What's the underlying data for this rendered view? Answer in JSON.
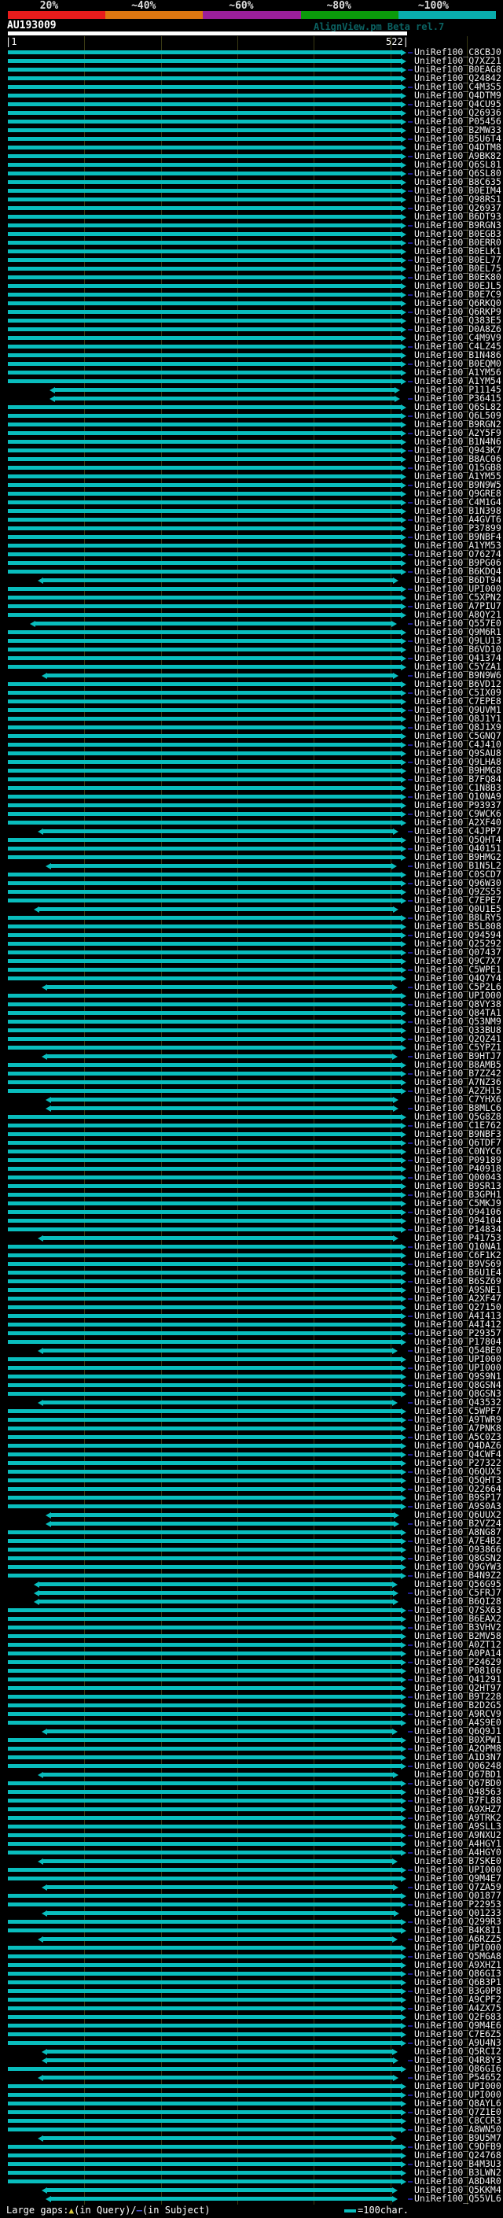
{
  "colors": {
    "background": "#000000",
    "alignment_bar": "#09bdbd",
    "subject_tail": "#1d1d8e",
    "query_bar": "#ffffff",
    "gridline": "#3a3a14",
    "label_text": "#ececec",
    "watermark_text": "#0b6161",
    "gap_query_symbol": "#d8c83c",
    "gap_subject_symbol": "#4a55c8"
  },
  "chart_data": {
    "type": "bar",
    "orientation": "horizontal",
    "title": "AU193009",
    "watermark": "AlignView.pm Beta rel.7",
    "x_axis": {
      "start": 1,
      "end": 522,
      "start_label": "|1",
      "end_label": "522|",
      "gridline_interval_chars": 100,
      "unit": "char"
    },
    "identity_scale": {
      "segments": [
        {
          "label": "20%",
          "color": "#e81c1c"
        },
        {
          "label": "~40%",
          "color": "#dd7711"
        },
        {
          "label": "~60%",
          "color": "#9b1f9b"
        },
        {
          "label": "~80%",
          "color": "#0b9b0b"
        },
        {
          "label": "~100%",
          "color": "#09adad"
        }
      ]
    },
    "legend": {
      "large_gaps_label": "Large gaps:",
      "query_symbol": "▲",
      "query_text": "(in Query)/",
      "subject_symbol": "—",
      "subject_text": "(in Subject)",
      "scale_note": "=100char."
    },
    "bars": [
      [
        "UniRef100_C8CBJ0",
        1,
        522
      ],
      [
        "UniRef100_Q7XZ21",
        1,
        522
      ],
      [
        "UniRef100_B0EAG8",
        1,
        522
      ],
      [
        "UniRef100_Q24842",
        1,
        522
      ],
      [
        "UniRef100_C4M3S5",
        1,
        522
      ],
      [
        "UniRef100_Q4DTM9",
        1,
        522
      ],
      [
        "UniRef100_Q4CU95",
        1,
        522
      ],
      [
        "UniRef100_Q26936",
        1,
        522
      ],
      [
        "UniRef100_P05456",
        1,
        522
      ],
      [
        "UniRef100_B2MW33",
        1,
        522
      ],
      [
        "UniRef100_B5U6T4",
        1,
        522
      ],
      [
        "UniRef100_Q4DTM8",
        1,
        522
      ],
      [
        "UniRef100_A9BK82",
        1,
        522
      ],
      [
        "UniRef100_Q6SL81",
        1,
        522
      ],
      [
        "UniRef100_Q6SL80",
        1,
        522
      ],
      [
        "UniRef100_B8C635",
        1,
        522
      ],
      [
        "UniRef100_B0EIM4",
        1,
        522
      ],
      [
        "UniRef100_Q98RS1",
        1,
        522
      ],
      [
        "UniRef100_Q26937",
        1,
        522
      ],
      [
        "UniRef100_B6DT93",
        1,
        522
      ],
      [
        "UniRef100_B9RGN3",
        1,
        522
      ],
      [
        "UniRef100_B0EGB3",
        1,
        522
      ],
      [
        "UniRef100_B0ERR0",
        1,
        522
      ],
      [
        "UniRef100_B0ELK1",
        1,
        522
      ],
      [
        "UniRef100_B0EL77",
        1,
        522
      ],
      [
        "UniRef100_B0EL75",
        1,
        522
      ],
      [
        "UniRef100_B0EK80",
        1,
        522
      ],
      [
        "UniRef100_B0EJL5",
        1,
        522
      ],
      [
        "UniRef100_B0E7C9",
        1,
        522
      ],
      [
        "UniRef100_Q6RKQ0",
        1,
        522
      ],
      [
        "UniRef100_Q6RKP9",
        1,
        522
      ],
      [
        "UniRef100_Q383E5",
        1,
        522
      ],
      [
        "UniRef100_D0A8Z6",
        1,
        522
      ],
      [
        "UniRef100_C4M9V9",
        1,
        522
      ],
      [
        "UniRef100_C4LZ45",
        1,
        522
      ],
      [
        "UniRef100_B1N486",
        1,
        522
      ],
      [
        "UniRef100_B0EQM0",
        1,
        522
      ],
      [
        "UniRef100_A1YM56",
        1,
        522
      ],
      [
        "UniRef100_A1YM54",
        1,
        522
      ],
      [
        "UniRef100_P11145",
        55,
        514
      ],
      [
        "UniRef100_P36415",
        55,
        514
      ],
      [
        "UniRef100_Q6SL82",
        1,
        522
      ],
      [
        "UniRef100_Q6L509",
        1,
        522
      ],
      [
        "UniRef100_B9RGN2",
        1,
        522
      ],
      [
        "UniRef100_A2Y5F9",
        1,
        522
      ],
      [
        "UniRef100_B1N4N6",
        1,
        522
      ],
      [
        "UniRef100_Q943K7",
        1,
        522
      ],
      [
        "UniRef100_B8AC06",
        1,
        522
      ],
      [
        "UniRef100_Q15GB8",
        1,
        522
      ],
      [
        "UniRef100_A1YM55",
        1,
        522
      ],
      [
        "UniRef100_B9N9W5",
        1,
        522
      ],
      [
        "UniRef100_Q9GRE8",
        1,
        522
      ],
      [
        "UniRef100_C4M1G4",
        1,
        522
      ],
      [
        "UniRef100_B1N398",
        1,
        522
      ],
      [
        "UniRef100_A4GVT6",
        1,
        522
      ],
      [
        "UniRef100_P37899",
        1,
        522
      ],
      [
        "UniRef100_B9NBF4",
        1,
        522
      ],
      [
        "UniRef100_A1YM53",
        1,
        522
      ],
      [
        "UniRef100_O76274",
        1,
        522
      ],
      [
        "UniRef100_B9PG06",
        1,
        522
      ],
      [
        "UniRef100_B6KDQ4",
        1,
        522
      ],
      [
        "UniRef100_B6DT94",
        40,
        512
      ],
      [
        "UniRef100_UPI000..",
        1,
        522
      ],
      [
        "UniRef100_C5XPN2",
        1,
        522
      ],
      [
        "UniRef100_A7PIU7",
        1,
        522
      ],
      [
        "UniRef100_A8QY21",
        1,
        522
      ],
      [
        "UniRef100_Q557E0",
        30,
        510
      ],
      [
        "UniRef100_Q9M6R1",
        1,
        522
      ],
      [
        "UniRef100_Q9LU13",
        1,
        522
      ],
      [
        "UniRef100_B6VD10",
        1,
        522
      ],
      [
        "UniRef100_Q41374",
        1,
        522
      ],
      [
        "UniRef100_C5YZA1",
        1,
        522
      ],
      [
        "UniRef100_B9N9W6",
        45,
        512
      ],
      [
        "UniRef100_B6VD12",
        1,
        522
      ],
      [
        "UniRef100_C5IX09",
        1,
        522
      ],
      [
        "UniRef100_C7EPE8",
        1,
        522
      ],
      [
        "UniRef100_Q9UVM1",
        1,
        522
      ],
      [
        "UniRef100_Q8J1Y1",
        1,
        522
      ],
      [
        "UniRef100_Q8J1X9",
        1,
        522
      ],
      [
        "UniRef100_C5GNQ7",
        1,
        522
      ],
      [
        "UniRef100_C4J410",
        1,
        522
      ],
      [
        "UniRef100_Q9SAU8",
        1,
        522
      ],
      [
        "UniRef100_Q9LHA8",
        1,
        522
      ],
      [
        "UniRef100_B9HMG8",
        1,
        522
      ],
      [
        "UniRef100_B7FQ84",
        1,
        522
      ],
      [
        "UniRef100_C1N8B3",
        1,
        522
      ],
      [
        "UniRef100_Q10NA9",
        1,
        522
      ],
      [
        "UniRef100_P93937",
        1,
        522
      ],
      [
        "UniRef100_C9WCK6",
        1,
        522
      ],
      [
        "UniRef100_A2XF40",
        1,
        522
      ],
      [
        "UniRef100_C4JPP7",
        40,
        512
      ],
      [
        "UniRef100_Q5QHT4",
        1,
        522
      ],
      [
        "UniRef100_Q40151",
        1,
        522
      ],
      [
        "UniRef100_B9HMG2",
        1,
        522
      ],
      [
        "UniRef100_B1N5L2",
        50,
        510
      ],
      [
        "UniRef100_C0SCD7",
        1,
        522
      ],
      [
        "UniRef100_Q96W30",
        1,
        522
      ],
      [
        "UniRef100_Q9ZS55",
        1,
        522
      ],
      [
        "UniRef100_C7EPE7",
        1,
        522
      ],
      [
        "UniRef100_Q0U1E5",
        35,
        512
      ],
      [
        "UniRef100_B8LRY5",
        1,
        522
      ],
      [
        "UniRef100_B5L808",
        1,
        522
      ],
      [
        "UniRef100_Q94594",
        1,
        522
      ],
      [
        "UniRef100_Q25292",
        1,
        522
      ],
      [
        "UniRef100_Q07437",
        1,
        522
      ],
      [
        "UniRef100_Q9C7X7",
        1,
        522
      ],
      [
        "UniRef100_C5WPE1",
        1,
        522
      ],
      [
        "UniRef100_Q4Q7Y4",
        1,
        522
      ],
      [
        "UniRef100_C5P2L6",
        45,
        511
      ],
      [
        "UniRef100_UPI000..",
        1,
        522
      ],
      [
        "UniRef100_Q8VY38",
        1,
        522
      ],
      [
        "UniRef100_Q84TA1",
        1,
        522
      ],
      [
        "UniRef100_Q53NM9",
        1,
        522
      ],
      [
        "UniRef100_Q33BU8",
        1,
        522
      ],
      [
        "UniRef100_Q2QZ41",
        1,
        522
      ],
      [
        "UniRef100_C5YPZ1",
        1,
        522
      ],
      [
        "UniRef100_B9HTJ7",
        45,
        511
      ],
      [
        "UniRef100_B8AMB5",
        1,
        522
      ],
      [
        "UniRef100_B7ZZ42",
        1,
        522
      ],
      [
        "UniRef100_A7NZ36",
        1,
        522
      ],
      [
        "UniRef100_A2ZH15",
        1,
        522
      ],
      [
        "UniRef100_C7YHX6",
        50,
        512
      ],
      [
        "UniRef100_B8MLC6",
        50,
        512
      ],
      [
        "UniRef100_Q5G8Z8",
        1,
        522
      ],
      [
        "UniRef100_C1E762",
        1,
        522
      ],
      [
        "UniRef100_B9NBF3",
        1,
        522
      ],
      [
        "UniRef100_Q6TDF7",
        1,
        522
      ],
      [
        "UniRef100_C0NYC6",
        1,
        522
      ],
      [
        "UniRef100_P09189",
        1,
        522
      ],
      [
        "UniRef100_P40918",
        1,
        522
      ],
      [
        "UniRef100_Q00043",
        1,
        522
      ],
      [
        "UniRef100_B9SR13",
        1,
        522
      ],
      [
        "UniRef100_B3GPH1",
        1,
        522
      ],
      [
        "UniRef100_C5MKJ9",
        1,
        522
      ],
      [
        "UniRef100_O94106",
        1,
        522
      ],
      [
        "UniRef100_O94104",
        1,
        522
      ],
      [
        "UniRef100_P14834",
        1,
        522
      ],
      [
        "UniRef100_P41753",
        40,
        512
      ],
      [
        "UniRef100_Q10NA1",
        1,
        522
      ],
      [
        "UniRef100_C6F1K2",
        1,
        522
      ],
      [
        "UniRef100_B9VS69",
        1,
        522
      ],
      [
        "UniRef100_B6U1E4",
        1,
        522
      ],
      [
        "UniRef100_B6SZ69",
        1,
        522
      ],
      [
        "UniRef100_A9SNE1",
        1,
        522
      ],
      [
        "UniRef100_A2XF47",
        1,
        522
      ],
      [
        "UniRef100_Q27150",
        1,
        522
      ],
      [
        "UniRef100_A4I413",
        1,
        522
      ],
      [
        "UniRef100_A4I412",
        1,
        522
      ],
      [
        "UniRef100_P29357",
        1,
        522
      ],
      [
        "UniRef100_P17804",
        1,
        522
      ],
      [
        "UniRef100_Q54BE0",
        40,
        511
      ],
      [
        "UniRef100_UPI000..",
        1,
        522
      ],
      [
        "UniRef100_UPI000..",
        1,
        522
      ],
      [
        "UniRef100_Q9S9N1",
        1,
        522
      ],
      [
        "UniRef100_Q8GSN4",
        1,
        522
      ],
      [
        "UniRef100_Q8GSN3",
        1,
        522
      ],
      [
        "UniRef100_Q43532",
        40,
        511
      ],
      [
        "UniRef100_C5WPF7",
        1,
        522
      ],
      [
        "UniRef100_A9TWR9",
        1,
        522
      ],
      [
        "UniRef100_A7PNK8",
        1,
        522
      ],
      [
        "UniRef100_A5C0Z3",
        1,
        522
      ],
      [
        "UniRef100_Q4DAZ6",
        1,
        522
      ],
      [
        "UniRef100_Q4CWF4",
        1,
        522
      ],
      [
        "UniRef100_P27322",
        1,
        522
      ],
      [
        "UniRef100_Q6QUX5",
        1,
        522
      ],
      [
        "UniRef100_Q5QHT3",
        1,
        522
      ],
      [
        "UniRef100_O22664",
        1,
        522
      ],
      [
        "UniRef100_B9SP17",
        1,
        522
      ],
      [
        "UniRef100_A9S0A3",
        1,
        522
      ],
      [
        "UniRef100_Q6UUX2",
        50,
        513
      ],
      [
        "UniRef100_B2VZ24",
        50,
        513
      ],
      [
        "UniRef100_A8NG87",
        1,
        522
      ],
      [
        "UniRef100_A7E4B2",
        1,
        522
      ],
      [
        "UniRef100_O93866",
        1,
        522
      ],
      [
        "UniRef100_Q8GSN2",
        1,
        522
      ],
      [
        "UniRef100_Q9GYW3",
        1,
        522
      ],
      [
        "UniRef100_B4N9Z2",
        1,
        522
      ],
      [
        "UniRef100_Q56G95",
        35,
        511
      ],
      [
        "UniRef100_C5FRJ7",
        35,
        512
      ],
      [
        "UniRef100_B6QI28",
        35,
        512
      ],
      [
        "UniRef100_Q7SX63",
        1,
        522
      ],
      [
        "UniRef100_B6EAX2",
        1,
        522
      ],
      [
        "UniRef100_B3VHV2",
        1,
        522
      ],
      [
        "UniRef100_B2MV58",
        1,
        522
      ],
      [
        "UniRef100_A0ZT12",
        1,
        522
      ],
      [
        "UniRef100_A0PA14",
        1,
        522
      ],
      [
        "UniRef100_P24629",
        1,
        522
      ],
      [
        "UniRef100_P08106",
        1,
        522
      ],
      [
        "UniRef100_Q41291",
        1,
        522
      ],
      [
        "UniRef100_Q2HT97",
        1,
        522
      ],
      [
        "UniRef100_B9T228",
        1,
        522
      ],
      [
        "UniRef100_B2D2G5",
        1,
        522
      ],
      [
        "UniRef100_A9RCV9",
        1,
        522
      ],
      [
        "UniRef100_A4S9E0",
        1,
        522
      ],
      [
        "UniRef100_Q6Q9J1",
        45,
        511
      ],
      [
        "UniRef100_B0XPW1",
        1,
        522
      ],
      [
        "UniRef100_A2QPM8",
        1,
        522
      ],
      [
        "UniRef100_A1D3N7",
        1,
        522
      ],
      [
        "UniRef100_Q06248",
        1,
        522
      ],
      [
        "UniRef100_Q67BD1",
        40,
        512
      ],
      [
        "UniRef100_Q67BD0",
        1,
        522
      ],
      [
        "UniRef100_O48563",
        1,
        522
      ],
      [
        "UniRef100_B7FL88",
        1,
        522
      ],
      [
        "UniRef100_A9XHZ7",
        1,
        522
      ],
      [
        "UniRef100_A9TRK2",
        1,
        522
      ],
      [
        "UniRef100_A9SLL3",
        1,
        522
      ],
      [
        "UniRef100_A9NXU2",
        1,
        522
      ],
      [
        "UniRef100_A4HGY1",
        1,
        522
      ],
      [
        "UniRef100_A4HGY0",
        1,
        522
      ],
      [
        "UniRef100_B7SKE0",
        40,
        511
      ],
      [
        "UniRef100_UPI000..",
        1,
        522
      ],
      [
        "UniRef100_Q9M4E7",
        1,
        522
      ],
      [
        "UniRef100_Q7ZA59",
        45,
        512
      ],
      [
        "UniRef100_Q01877",
        1,
        522
      ],
      [
        "UniRef100_P22953",
        1,
        522
      ],
      [
        "UniRef100_Q01233",
        45,
        513
      ],
      [
        "UniRef100_Q299R3",
        1,
        522
      ],
      [
        "UniRef100_B4K8I1",
        1,
        522
      ],
      [
        "UniRef100_A6RZZ5",
        40,
        511
      ],
      [
        "UniRef100_UPI000..",
        1,
        522
      ],
      [
        "UniRef100_Q5MGA8",
        1,
        522
      ],
      [
        "UniRef100_A9XHZ1",
        1,
        522
      ],
      [
        "UniRef100_Q86GI3",
        1,
        522
      ],
      [
        "UniRef100_Q6B3P1",
        1,
        522
      ],
      [
        "UniRef100_B3G0P8",
        1,
        522
      ],
      [
        "UniRef100_A9CPF2",
        1,
        522
      ],
      [
        "UniRef100_A4ZX75",
        1,
        522
      ],
      [
        "UniRef100_Q2F683",
        1,
        522
      ],
      [
        "UniRef100_Q9M4E6",
        1,
        522
      ],
      [
        "UniRef100_C7E6Z5",
        1,
        522
      ],
      [
        "UniRef100_A9U4N3",
        1,
        522
      ],
      [
        "UniRef100_Q5RCI2",
        45,
        511
      ],
      [
        "UniRef100_Q4R8Y3",
        45,
        512
      ],
      [
        "UniRef100_Q86GI6",
        1,
        522
      ],
      [
        "UniRef100_P54652",
        40,
        512
      ],
      [
        "UniRef100_UPI000..",
        1,
        522
      ],
      [
        "UniRef100_UPI000..",
        1,
        522
      ],
      [
        "UniRef100_Q8AYL6",
        1,
        522
      ],
      [
        "UniRef100_Q7Z1E0",
        1,
        522
      ],
      [
        "UniRef100_C8CCR3",
        1,
        522
      ],
      [
        "UniRef100_A8WN50",
        1,
        522
      ],
      [
        "UniRef100_B9U5M7",
        40,
        510
      ],
      [
        "UniRef100_C9DFB9",
        1,
        522
      ],
      [
        "UniRef100_Q24768",
        1,
        522
      ],
      [
        "UniRef100_B4M3U3",
        1,
        522
      ],
      [
        "UniRef100_B3LWN2",
        1,
        522
      ],
      [
        "UniRef100_A8D4R0",
        1,
        522
      ],
      [
        "UniRef100_Q5KKM4",
        45,
        511
      ],
      [
        "UniRef100_Q55VL6",
        50,
        511
      ]
    ]
  }
}
